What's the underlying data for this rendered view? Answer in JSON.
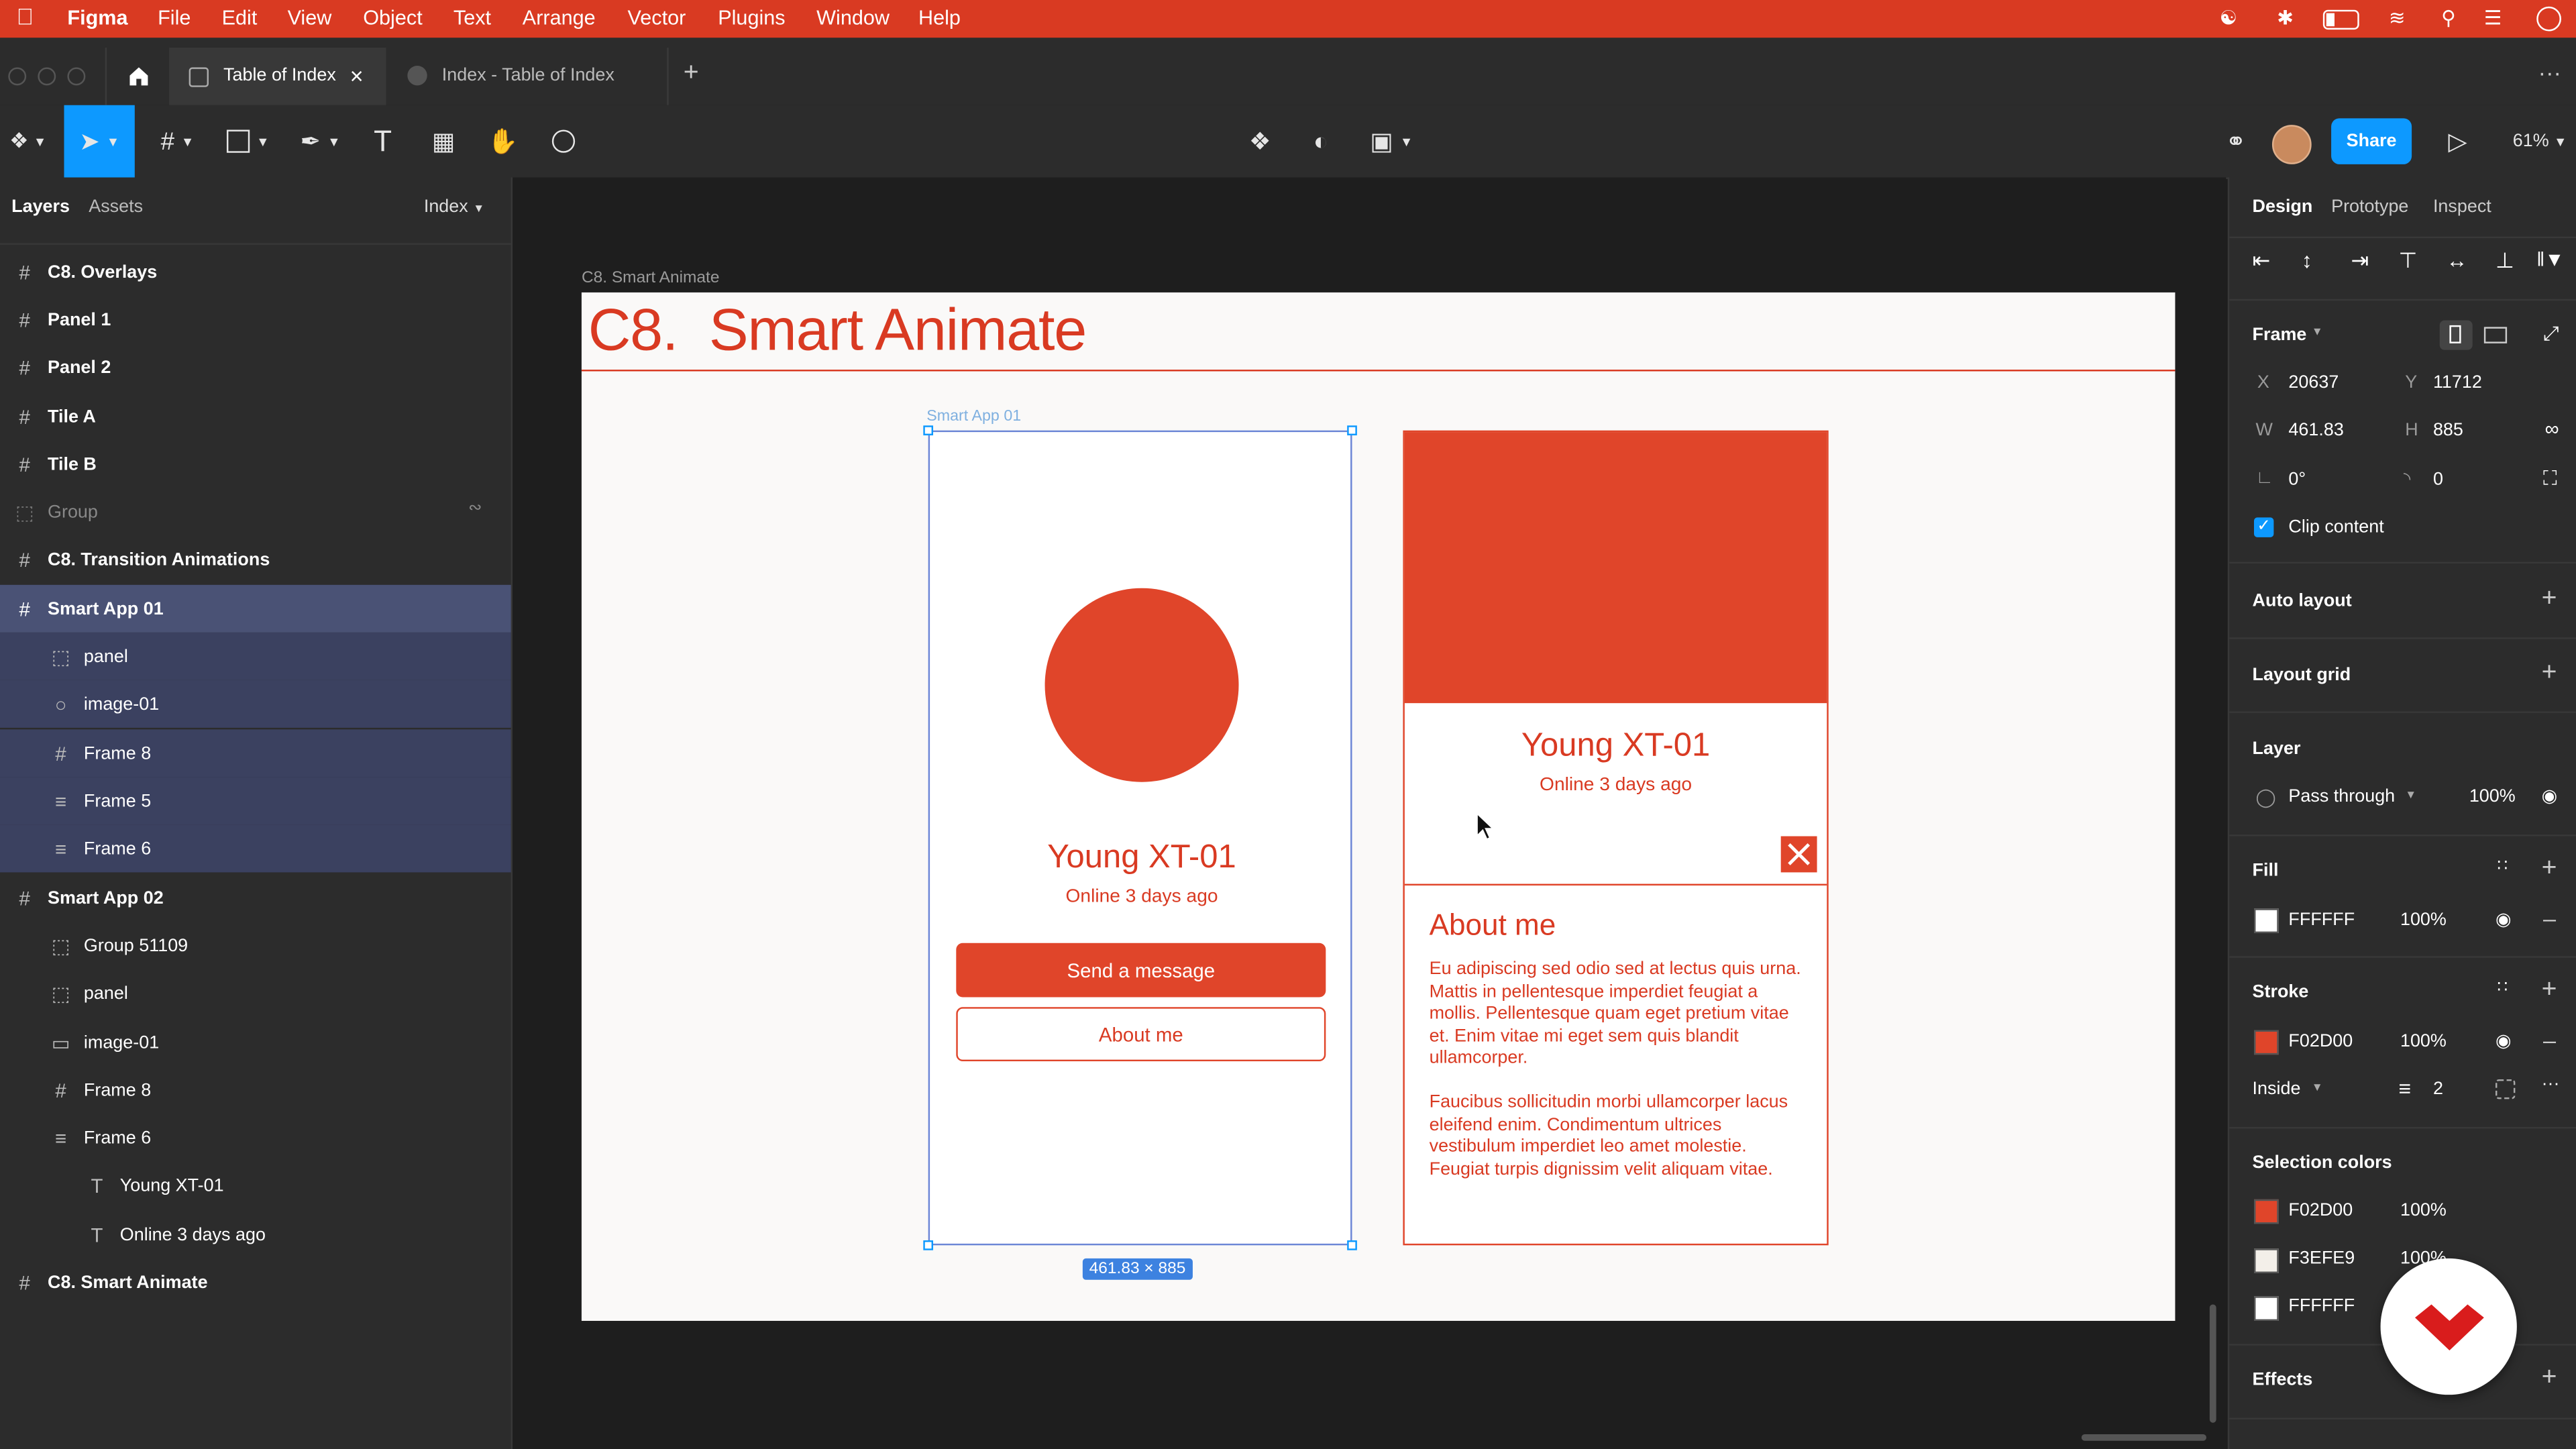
{
  "menubar": {
    "apple": "",
    "app": "Figma",
    "items": [
      "File",
      "Edit",
      "View",
      "Object",
      "Text",
      "Arrange",
      "Vector",
      "Plugins",
      "Window",
      "Help"
    ]
  },
  "tabs": {
    "active": "Table of Index",
    "inactive": "Index - Table of Index",
    "add": "+"
  },
  "toolbar": {
    "share_label": "Share",
    "zoom": "61%",
    "more": "···"
  },
  "left_panel": {
    "tab_layers": "Layers",
    "tab_assets": "Assets",
    "page": "Index",
    "layers": [
      {
        "label": "C8. Overlays"
      },
      {
        "label": "Panel 1"
      },
      {
        "label": "Panel 2"
      },
      {
        "label": "Tile A"
      },
      {
        "label": "Tile B"
      },
      {
        "label": "Group"
      },
      {
        "label": "C8. Transition Animations"
      },
      {
        "label": "Smart App 01"
      },
      {
        "label": "panel"
      },
      {
        "label": "image-01"
      },
      {
        "label": "Frame 8"
      },
      {
        "label": "Frame 5"
      },
      {
        "label": "Frame 6"
      },
      {
        "label": "Smart App 02"
      },
      {
        "label": "Group 51109"
      },
      {
        "label": "panel"
      },
      {
        "label": "image-01"
      },
      {
        "label": "Frame 8"
      },
      {
        "label": "Frame 6"
      },
      {
        "label": "Young XT-01"
      },
      {
        "label": "Online 3 days ago"
      },
      {
        "label": "C8. Smart Animate"
      }
    ]
  },
  "canvas": {
    "frame_label": "C8. Smart Animate",
    "heading_num": "C8.",
    "heading_text": "Smart Animate",
    "app1_label": "Smart App 01",
    "dimension": "461.83 × 885",
    "card1": {
      "name": "Young XT-01",
      "status": "Online 3 days ago",
      "send_btn": "Send a message",
      "about_btn": "About me"
    },
    "card2": {
      "name": "Young XT-01",
      "status": "Online 3 days ago",
      "about_heading": "About me",
      "para1": "Eu adipiscing sed odio sed at lectus quis urna. Mattis in pellentesque imperdiet feugiat a mollis. Pellentesque quam eget pretium vitae et. Enim vitae mi eget sem quis blandit ullamcorper.",
      "para2": "Faucibus sollicitudin morbi ullamcorper lacus eleifend enim. Condimentum ultrices vestibulum imperdiet leo amet molestie. Feugiat turpis dignissim velit aliquam vitae."
    }
  },
  "right_panel": {
    "tab_design": "Design",
    "tab_prototype": "Prototype",
    "tab_inspect": "Inspect",
    "frame_label": "Frame",
    "x_label": "X",
    "x_value": "20637",
    "y_label": "Y",
    "y_value": "11712",
    "w_label": "W",
    "w_value": "461.83",
    "h_label": "H",
    "h_value": "885",
    "rotation": "0°",
    "radius": "0",
    "clip_content": "Clip content",
    "auto_layout": "Auto layout",
    "layout_grid": "Layout grid",
    "layer": "Layer",
    "blend": "Pass through",
    "layer_opacity": "100%",
    "fill": "Fill",
    "fill_hex": "FFFFFF",
    "fill_opacity": "100%",
    "stroke": "Stroke",
    "stroke_hex": "F02D00",
    "stroke_opacity": "100%",
    "stroke_position": "Inside",
    "stroke_weight": "2",
    "selection_colors": "Selection colors",
    "sel_colors": [
      {
        "hex": "F02D00",
        "opacity": "100%",
        "color": "#e0452a"
      },
      {
        "hex": "F3EFE9",
        "opacity": "100%",
        "color": "#f3efe9"
      },
      {
        "hex": "FFFFFF",
        "opacity": "",
        "color": "#ffffff"
      }
    ],
    "effects": "Effects"
  },
  "colors": {
    "accent": "#d93a22",
    "brand_red": "#e0452a",
    "figma_blue": "#0d99ff"
  }
}
